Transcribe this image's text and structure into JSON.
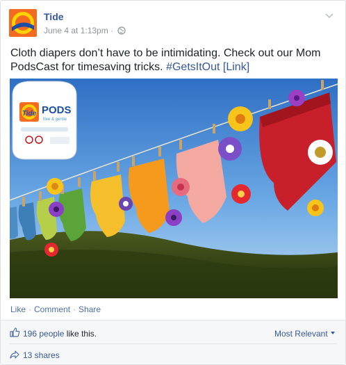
{
  "post": {
    "page_name": "Tide",
    "timestamp": "June 4 at 1:13pm",
    "meta_sep": "·",
    "text_main": "Cloth diapers don’t have to be intimidating. Check out our Mom PodsCast for timesaving tricks.",
    "hashtag": "#GetsItOut",
    "link": "[Link]"
  },
  "logo": {
    "text": "Tide",
    "colors": {
      "orange": "#f26b21",
      "yellow": "#ffd200",
      "blue": "#1e4ea1"
    }
  },
  "photo": {
    "product_brand": "Tide",
    "product_name": "PODS",
    "product_variant": "free & gentle"
  },
  "actions": {
    "like": "Like",
    "comment": "Comment",
    "share": "Share",
    "sep": "·"
  },
  "footer": {
    "likes_link": "196 people",
    "likes_suffix": " like this.",
    "sort_label": "Most Relevant",
    "shares": "13 shares"
  },
  "icons": {
    "globe": "globe-icon",
    "chevron": "chevron-down-icon",
    "thumb": "thumbs-up-icon",
    "share": "share-arrow-icon"
  }
}
